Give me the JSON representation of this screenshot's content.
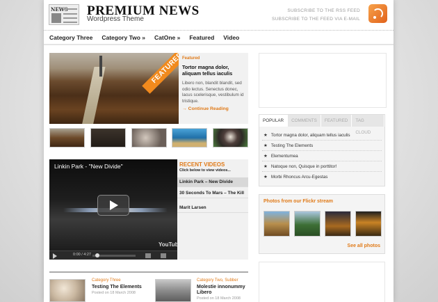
{
  "header": {
    "title": "PREMIUM NEWS",
    "tagline": "Wordpress Theme",
    "rss_line1": "SUBSCRIBE TO THE RSS FEED",
    "rss_line2": "SUBSCRIBE TO THE FEED VIA E-MAIL",
    "logo_text": "NEWS"
  },
  "nav": {
    "items": [
      "Category Three",
      "Category Two »",
      "CatOne »",
      "Featured",
      "Video"
    ]
  },
  "featured": {
    "ribbon": "FEATURED",
    "tag": "Featured",
    "title": "Tortor magna dolor, aliquam tellus iaculis",
    "excerpt": "Libero non, blandit blandit, sed odio lectus. Senectus donec, lacus scelerisque, vestibulum id tristique.",
    "more": "→ Continue Reading"
  },
  "video": {
    "title": "Linkin Park - \"New Divide\"",
    "time": "0:00 / 4:27",
    "logo": "YouTube"
  },
  "recent_videos": {
    "title": "RECENT VIDEOS",
    "subtitle": "Click below to view videos...",
    "items": [
      "Linkin Park – New Divide",
      "30 Seconds To Mars – The Kill",
      "Marit Larsen"
    ]
  },
  "articles": [
    {
      "category": "Category Three",
      "title": "Testing The Elements",
      "date": "Posted on 18 March 2008"
    },
    {
      "category": "Category Two, Subber",
      "title": "Molestie innonummy Libero",
      "date": "Posted on 18 March 2008"
    }
  ],
  "sidebar": {
    "tabs": [
      "POPULAR",
      "COMMENTS",
      "FEATURED",
      "TAG CLOUD"
    ],
    "popular": [
      "Tortor magna dolor, aliquam tellus iaculis",
      "Testing The Elements",
      "Elementumea",
      "Natoque non, Quisque in porttitor!",
      "Morbi Rhoncus Arcu-Egestas"
    ],
    "flickr_title": "Photos from our Flickr stream",
    "flickr_more": "See all photos"
  },
  "colors": {
    "accent": "#f18a1d",
    "text": "#222222"
  }
}
